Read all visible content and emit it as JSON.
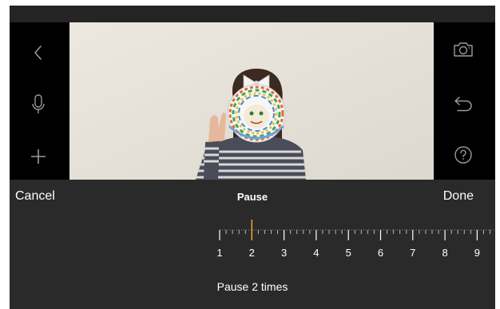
{
  "toolbar": {
    "back_icon": "chevron-left-icon",
    "mic_icon": "microphone-icon",
    "add_icon": "plus-icon",
    "camera_icon": "camera-icon",
    "undo_icon": "undo-arrow-icon",
    "help_icon": "question-mark-icon"
  },
  "editor": {
    "cancel_label": "Cancel",
    "title": "Pause",
    "done_label": "Done",
    "ruler_labels": [
      "1",
      "2",
      "3",
      "4",
      "5",
      "6",
      "7",
      "8",
      "9"
    ],
    "selected_value": 2,
    "summary": "Pause 2 times"
  },
  "colors": {
    "background": "#242424",
    "panel": "#000000",
    "editbar": "#2a2a2a",
    "indicator": "#e0a13a",
    "text": "#ffffff"
  }
}
